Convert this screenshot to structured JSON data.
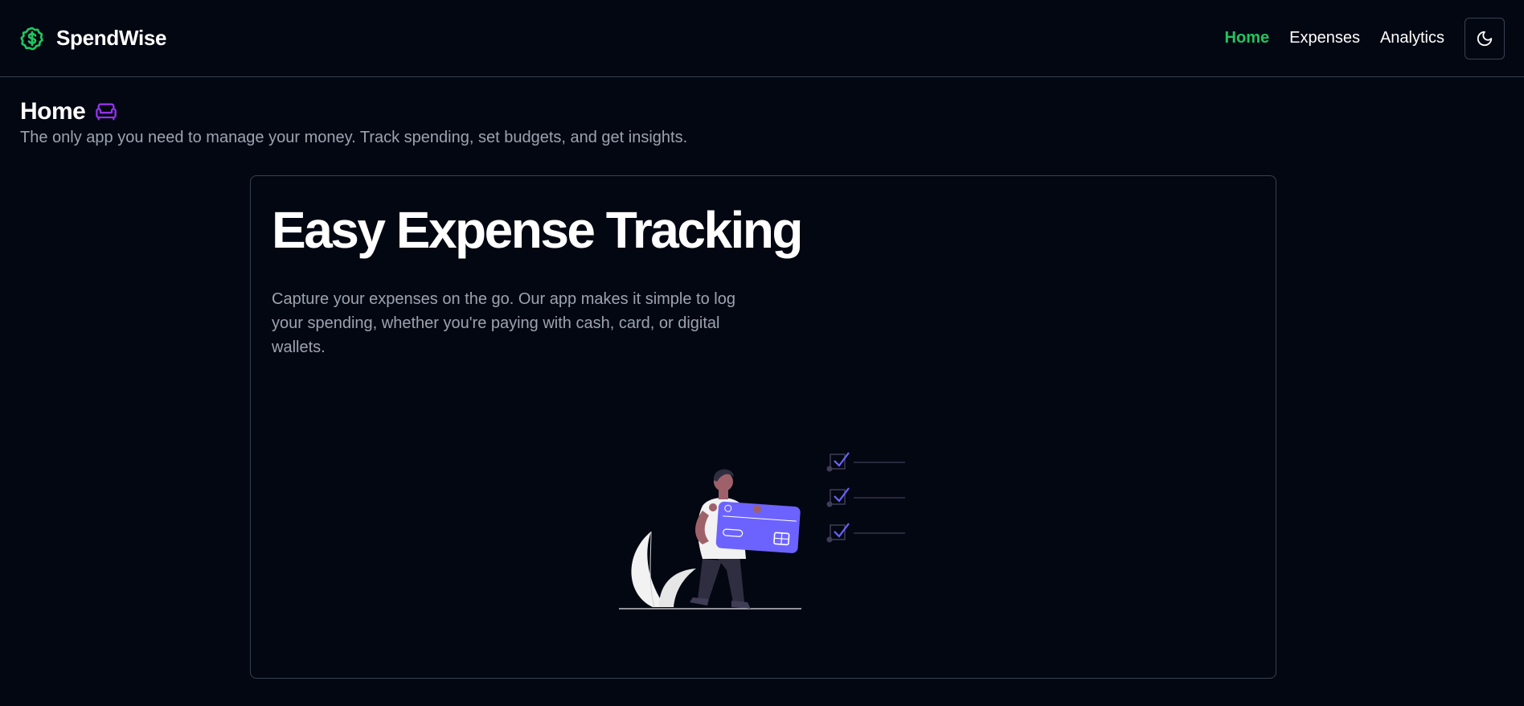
{
  "brand": {
    "name": "SpendWise",
    "icon": "dollar-circle-icon",
    "color": "#22c55e"
  },
  "nav": {
    "items": [
      {
        "label": "Home",
        "active": true
      },
      {
        "label": "Expenses",
        "active": false
      },
      {
        "label": "Analytics",
        "active": false
      }
    ],
    "theme_toggle_icon": "moon-icon"
  },
  "page": {
    "title": "Home",
    "title_icon": "sofa-icon",
    "subtitle": "The only app you need to manage your money. Track spending, set budgets, and get insights."
  },
  "hero": {
    "title": "Easy Expense Tracking",
    "description": "Capture your expenses on the go. Our app makes it simple to log your spending, whether you're paying with cash, card, or digital wallets.",
    "illustration": "person-holding-credit-card-illustration"
  },
  "colors": {
    "background": "#030712",
    "accent_green": "#22c55e",
    "accent_purple": "#9333ea",
    "card_purple": "#6c63ff",
    "muted_text": "#9ca3af",
    "border": "#374151"
  }
}
